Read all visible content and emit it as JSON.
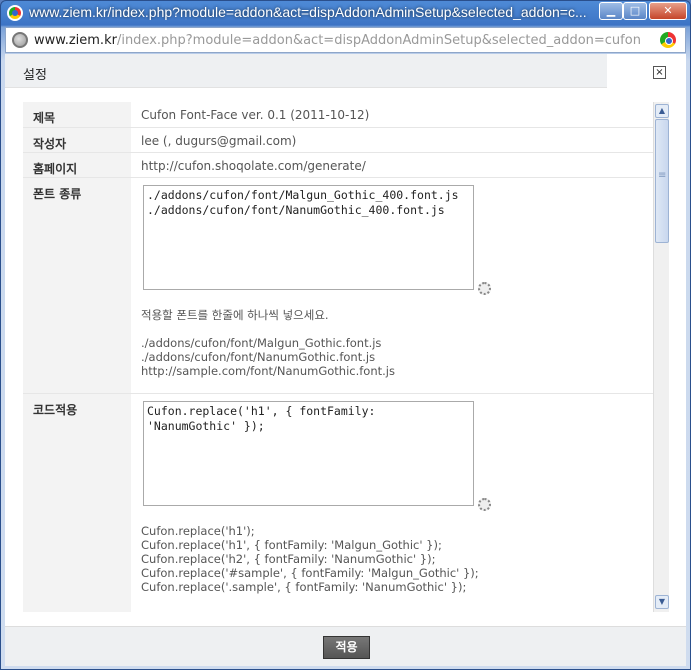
{
  "window": {
    "title": "www.ziem.kr/index.php?module=addon&act=dispAddonAdminSetup&selected_addon=c...",
    "min_label": "▁",
    "max_label": "□",
    "close_label": "✕"
  },
  "address": {
    "domain": "www.ziem.kr",
    "path": "/index.php?module=addon&act=dispAddonAdminSetup&selected_addon=cufon"
  },
  "dialog": {
    "title": "설정",
    "close_label": "×"
  },
  "fields": {
    "name_label": "제목",
    "name_value": "Cufon Font-Face ver. 0.1 (2011-10-12)",
    "author_label": "작성자",
    "author_value": "lee (, dugurs@gmail.com)",
    "homepage_label": "홈페이지",
    "homepage_value": "http://cufon.shoqolate.com/generate/",
    "fonts_label": "폰트 종류",
    "fonts_value": "./addons/cufon/font/Malgun_Gothic_400.font.js\n./addons/cufon/font/NanumGothic_400.font.js",
    "fonts_help": "적용할 폰트를 한줄에 하나씩 넣으세요.\n\n./addons/cufon/font/Malgun_Gothic.font.js\n./addons/cufon/font/NanumGothic.font.js\nhttp://sample.com/font/NanumGothic.font.js",
    "code_label": "코드적용",
    "code_value": "Cufon.replace('h1', { fontFamily: 'NanumGothic' });",
    "code_help": "Cufon.replace('h1');\nCufon.replace('h1', { fontFamily: 'Malgun_Gothic' });\nCufon.replace('h2', { fontFamily: 'NanumGothic' });\nCufon.replace('#sample', { fontFamily: 'Malgun_Gothic' });\nCufon.replace('.sample', { fontFamily: 'NanumGothic' });\n\n."
  },
  "scrollbar": {
    "up_label": "▲",
    "down_label": "▼"
  },
  "footer": {
    "apply_label": "적용"
  }
}
